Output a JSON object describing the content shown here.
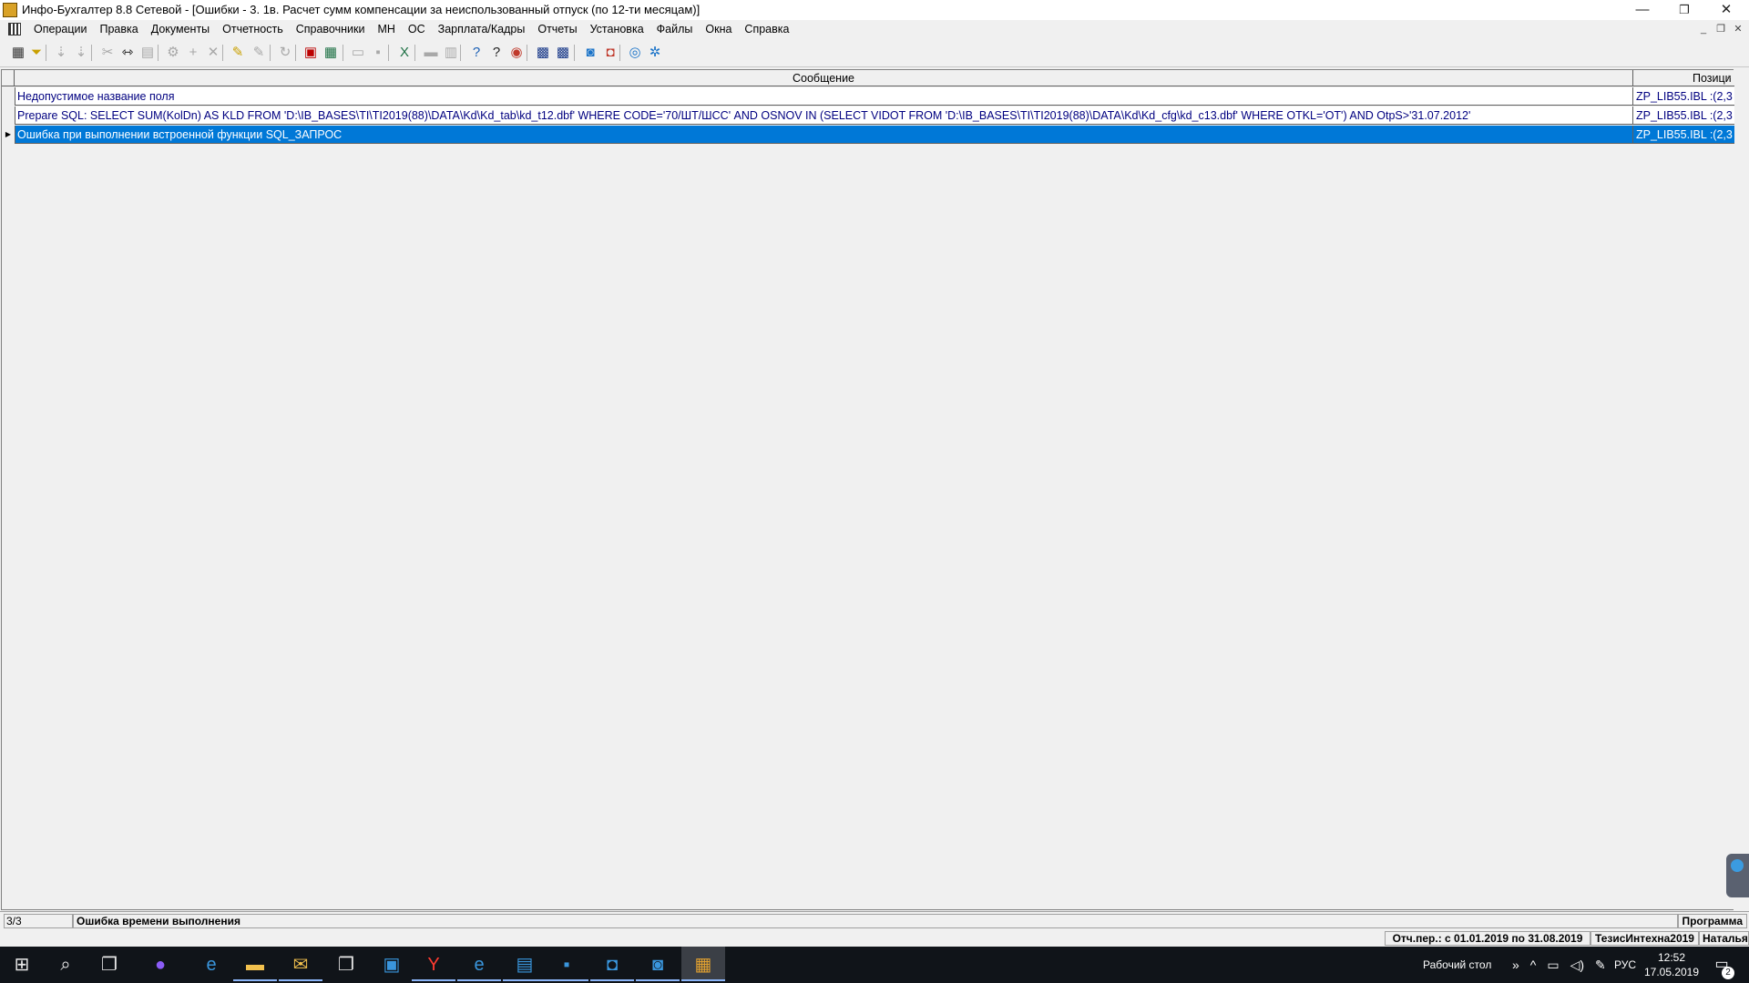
{
  "window": {
    "title": "Инфо-Бухгалтер 8.8 Сетевой - [Ошибки - 3. 1в. Расчет сумм компенсации за неиспользованный отпуск (по 12-ти месяцам)]",
    "min_glyph": "—",
    "max_glyph": "❐",
    "close_glyph": "✕"
  },
  "menu": {
    "items": [
      "Операции",
      "Правка",
      "Документы",
      "Отчетность",
      "Справочники",
      "МН",
      "ОС",
      "Зарплата/Кадры",
      "Отчеты",
      "Установка",
      "Файлы",
      "Окна",
      "Справка"
    ],
    "mdi_min": "_",
    "mdi_restore": "❐",
    "mdi_close": "✕"
  },
  "toolbar": {
    "icons": [
      "new-record-icon",
      "filter-icon",
      "sort-asc-icon",
      "sort-desc-icon",
      "cut-icon",
      "find-icon",
      "paste-icon",
      "settings-icon",
      "add-icon",
      "delete-icon",
      "mark-icon",
      "unmark-icon",
      "refresh-icon",
      "pdf-icon",
      "calculator-icon",
      "open-icon",
      "save-icon",
      "excel-icon",
      "print-icon",
      "preview-icon",
      "help-icon",
      "context-help-icon",
      "navigator-icon",
      "tasks-icon",
      "ns10-icon",
      "update-icon",
      "remote-help-icon",
      "web-icon",
      "network-icon"
    ],
    "glyphs": {
      "new-record-icon": "▦",
      "filter-icon": "⏷",
      "sort-asc-icon": "⇣",
      "sort-desc-icon": "⇣",
      "cut-icon": "✂",
      "find-icon": "⇿",
      "paste-icon": "▤",
      "settings-icon": "⚙",
      "add-icon": "+",
      "delete-icon": "✕",
      "mark-icon": "✎",
      "unmark-icon": "✎",
      "refresh-icon": "↻",
      "pdf-icon": "▣",
      "calculator-icon": "▦",
      "open-icon": "▭",
      "save-icon": "▪",
      "excel-icon": "X",
      "print-icon": "▬",
      "preview-icon": "▥",
      "help-icon": "?",
      "context-help-icon": "?",
      "navigator-icon": "◉",
      "tasks-icon": "▩",
      "ns10-icon": "▩",
      "update-icon": "◙",
      "remote-help-icon": "◘",
      "web-icon": "◎",
      "network-icon": "✲"
    }
  },
  "grid": {
    "columns": {
      "message": "Сообщение",
      "position": "Позици"
    },
    "sort_glyph": "^",
    "rows": [
      {
        "indicator": "",
        "message": "Недопустимое название поля",
        "position": "ZP_LIB55.IBL :(2,3"
      },
      {
        "indicator": "",
        "message": "Prepare SQL:   SELECT SUM(KolDn) AS KLD    FROM 'D:\\IB_BASES\\TI\\TI2019(88)\\DATA\\Kd\\Kd_tab\\kd_t12.dbf'    WHERE CODE='70/ШТ/ШСС'    AND OSNOV IN (SELECT VIDOT FROM 'D:\\IB_BASES\\TI\\TI2019(88)\\DATA\\Kd\\Kd_cfg\\kd_c13.dbf' WHERE OTKL='OT')    AND OtpS>'31.07.2012'",
        "position": "ZP_LIB55.IBL :(2,3"
      },
      {
        "indicator": "▶",
        "message": "Ошибка при выполнении встроенной функции SQL_ЗАПРОС",
        "position": "ZP_LIB55.IBL :(2,3"
      }
    ],
    "scroll_left": "◀",
    "scroll_right": "▶"
  },
  "status": {
    "count": "3/3",
    "message": "Ошибка времени выполнения",
    "mode": "Программа",
    "period": "Отч.пер.: с 01.01.2019 по 31.08.2019",
    "database": "ТезисИнтехна2019",
    "user": "Наталья"
  },
  "taskbar": {
    "apps": [
      {
        "name": "start-icon",
        "glyph": "⊞"
      },
      {
        "name": "search-icon",
        "glyph": "⌕"
      },
      {
        "name": "task-view-icon",
        "glyph": "❐"
      },
      {
        "name": "alice-icon",
        "glyph": "●"
      },
      {
        "name": "edge-icon",
        "glyph": "e"
      },
      {
        "name": "explorer-icon",
        "glyph": "▬"
      },
      {
        "name": "outlook-icon",
        "glyph": "✉"
      },
      {
        "name": "reader-icon",
        "glyph": "❐"
      },
      {
        "name": "network-app-icon",
        "glyph": "▣"
      },
      {
        "name": "yandex-browser-icon",
        "glyph": "Y"
      },
      {
        "name": "ie-icon",
        "glyph": "e"
      },
      {
        "name": "documents-icon",
        "glyph": "▤"
      },
      {
        "name": "save-app-icon",
        "glyph": "▪"
      },
      {
        "name": "teamviewer-icon",
        "glyph": "◘"
      },
      {
        "name": "shield-app-icon",
        "glyph": "◙"
      },
      {
        "name": "infobuh-icon",
        "glyph": "▦"
      }
    ],
    "desktop_label": "Рабочий стол",
    "tray_glyphs": [
      "»",
      "^",
      "▭",
      "◁)",
      "✎"
    ],
    "lang": "РУС",
    "time": "12:52",
    "date": "17.05.2019",
    "notify_glyph": "▭",
    "notify_count": "2"
  }
}
